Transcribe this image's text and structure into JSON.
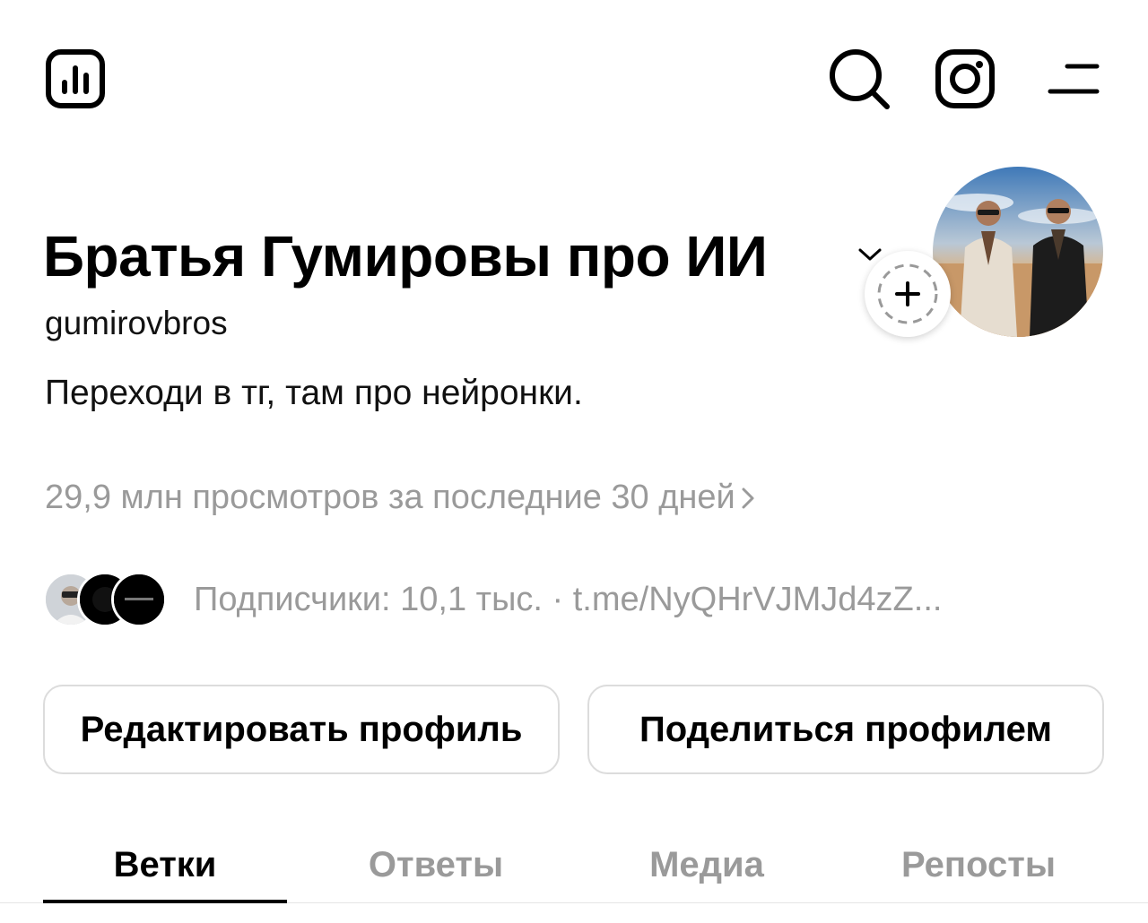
{
  "header": {
    "icons": [
      "insights-icon",
      "search-icon",
      "instagram-icon",
      "menu-icon"
    ]
  },
  "profile": {
    "display_name": "Братья Гумировы про ИИ",
    "username": "gumirovbros",
    "bio": "Переходи в тг, там про нейронки.",
    "views": "29,9 млн просмотров за последние 30 дней",
    "followers": "Подписчики: 10,1 тыс.",
    "separator": "·",
    "link": "t.me/NyQHrVJMJd4zZ..."
  },
  "actions": {
    "edit_label": "Редактировать профиль",
    "share_label": "Поделиться профилем"
  },
  "tabs": [
    {
      "label": "Ветки"
    },
    {
      "label": "Ответы"
    },
    {
      "label": "Медиа"
    },
    {
      "label": "Репосты"
    }
  ],
  "colors": {
    "text_primary": "#000000",
    "text_secondary": "#9a9a9a",
    "border": "#dcdcdc",
    "background": "#ffffff"
  }
}
